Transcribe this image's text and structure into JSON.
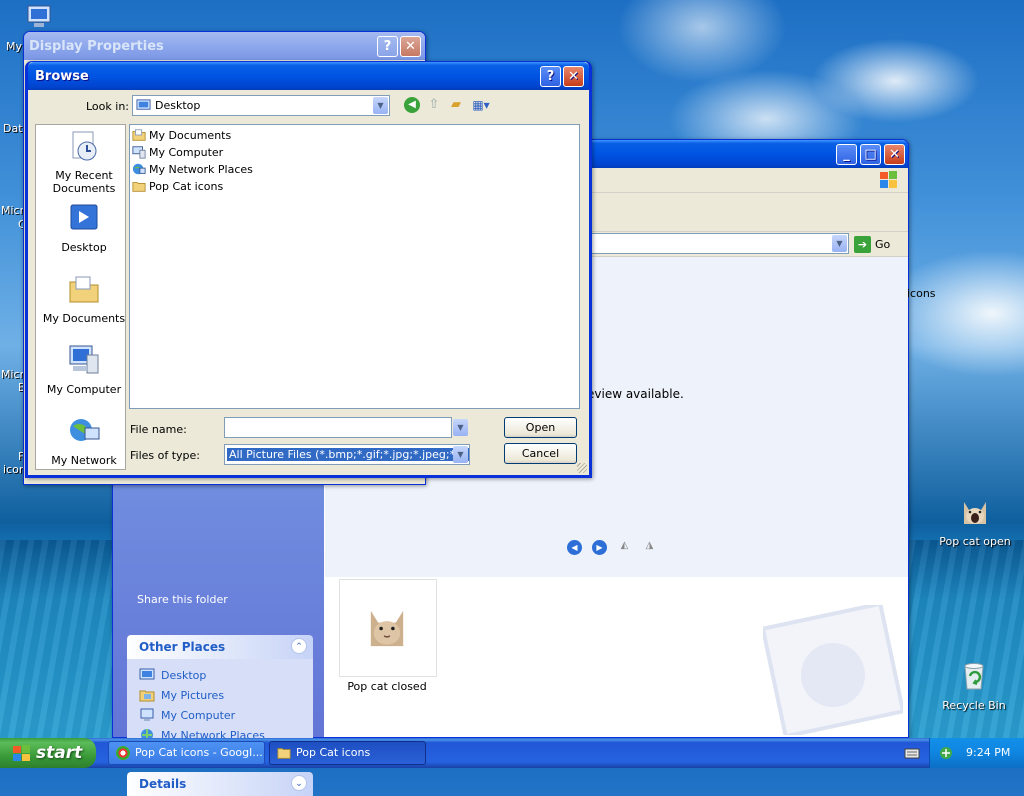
{
  "desktop": {
    "icons": [
      {
        "label": "Pop cat open"
      },
      {
        "label": "Recycle Bin"
      }
    ],
    "left_fragments": [
      "My",
      "Dat",
      "Micro",
      "C",
      "Micro",
      "B",
      "F",
      "icon"
    ],
    "window_fragment_icons": "icons",
    "window_fragment_preview": "eview available."
  },
  "display_properties": {
    "title": "Display Properties",
    "help_label": "?",
    "close_label": "✕"
  },
  "browse": {
    "title": "Browse",
    "help_label": "?",
    "close_label": "✕",
    "look_in_label": "Look in:",
    "look_in_value": "Desktop",
    "places": [
      {
        "label": "My Recent Documents",
        "icon": "recent-documents-icon"
      },
      {
        "label": "Desktop",
        "icon": "desktop-icon"
      },
      {
        "label": "My Documents",
        "icon": "my-documents-icon"
      },
      {
        "label": "My Computer",
        "icon": "my-computer-icon"
      },
      {
        "label": "My Network",
        "icon": "my-network-icon"
      }
    ],
    "files": [
      {
        "label": "My Documents",
        "icon": "folder-icon"
      },
      {
        "label": "My Computer",
        "icon": "computer-icon"
      },
      {
        "label": "My Network Places",
        "icon": "network-icon"
      },
      {
        "label": "Pop Cat icons",
        "icon": "folder-icon"
      }
    ],
    "file_name_label": "File name:",
    "file_name_value": "",
    "files_of_type_label": "Files of type:",
    "files_of_type_value": "All Picture Files (*.bmp;*.gif;*.jpg;*.jpeg;*.dib;*.png)",
    "open_label": "Open",
    "cancel_label": "Cancel"
  },
  "explorer": {
    "go_label": "Go",
    "share_folder_fragment": "Share this folder",
    "other_places_title": "Other Places",
    "other_places": [
      {
        "label": "Desktop"
      },
      {
        "label": "My Pictures"
      },
      {
        "label": "My Computer"
      },
      {
        "label": "My Network Places"
      }
    ],
    "details_title": "Details",
    "thumbnail_caption": "Pop cat closed",
    "min_label": "_",
    "max_label": "□",
    "close_label": "✕"
  },
  "taskbar": {
    "start_label": "start",
    "buttons": [
      {
        "label": "Pop Cat icons - Googl..."
      },
      {
        "label": "Pop Cat icons"
      }
    ],
    "clock": "9:24 PM"
  }
}
